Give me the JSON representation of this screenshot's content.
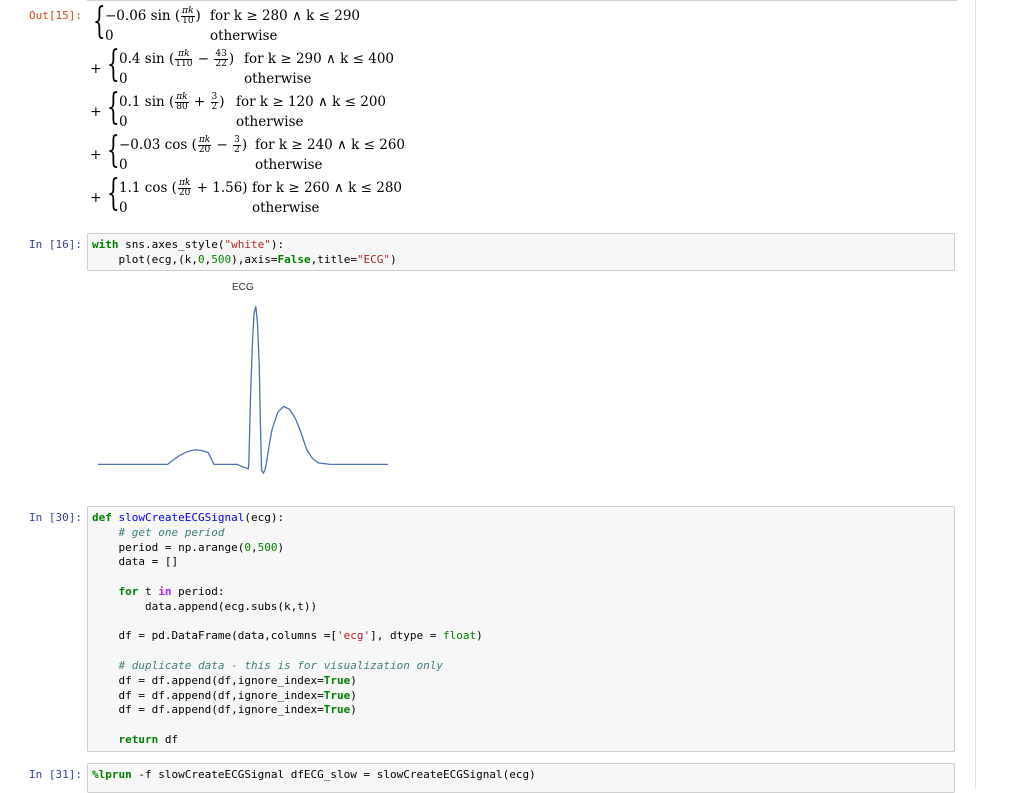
{
  "out15": {
    "prompt": "Out[15]:",
    "rows": [
      {
        "coef": "−0.06 sin",
        "arg_pre": "",
        "fnum": "πk",
        "fden": "10",
        "arg_post": "",
        "cond": "for k ≥ 280 ∧ k ≤ 290",
        "zero": "0",
        "otherwise": "otherwise",
        "plus": ""
      },
      {
        "coef": "0.4 sin",
        "arg_pre": "",
        "fnum": "πk",
        "fden": "110",
        "arg_post": "−",
        "fnum2": "43",
        "fden2": "22",
        "cond": "for k ≥ 290 ∧ k ≤ 400",
        "zero": "0",
        "otherwise": "otherwise",
        "plus": "+"
      },
      {
        "coef": "0.1 sin",
        "fnum": "πk",
        "fden": "80",
        "arg_post": "+",
        "fnum2": "3",
        "fden2": "2",
        "cond": "for k ≥ 120 ∧ k ≤ 200",
        "zero": "0",
        "otherwise": "otherwise",
        "plus": "+"
      },
      {
        "coef": "−0.03 cos",
        "fnum": "πk",
        "fden": "20",
        "arg_post": "−",
        "fnum2": "3",
        "fden2": "2",
        "cond": "for k ≥ 240 ∧ k ≤ 260",
        "zero": "0",
        "otherwise": "otherwise",
        "plus": "+"
      },
      {
        "coef": "1.1 cos",
        "fnum": "πk",
        "fden": "20",
        "arg_post": "+ 1.56",
        "cond": "for k ≥ 260 ∧ k ≤ 280",
        "zero": "0",
        "otherwise": "otherwise",
        "plus": "+"
      }
    ]
  },
  "in16": {
    "prompt": "In [16]:",
    "chart_title": "ECG"
  },
  "in30": {
    "prompt": "In [30]:"
  },
  "in31": {
    "prompt": "In [31]:"
  },
  "chart_data": {
    "type": "line",
    "title": "ECG",
    "xlabel": "",
    "ylabel": "",
    "axis": false,
    "x_range": [
      0,
      500
    ],
    "series": [
      {
        "color": "#4c72b0",
        "points": [
          [
            0,
            0
          ],
          [
            110,
            0
          ],
          [
            120,
            0
          ],
          [
            130,
            0.031
          ],
          [
            140,
            0.059
          ],
          [
            150,
            0.081
          ],
          [
            160,
            0.095
          ],
          [
            170,
            0.1
          ],
          [
            180,
            0.095
          ],
          [
            190,
            0.081
          ],
          [
            200,
            0.0
          ],
          [
            210,
            0
          ],
          [
            240,
            0
          ],
          [
            245,
            -0.009
          ],
          [
            250,
            -0.017
          ],
          [
            255,
            -0.024
          ],
          [
            259,
            -0.03
          ],
          [
            260,
            0.0
          ],
          [
            263,
            0.46
          ],
          [
            266,
            0.82
          ],
          [
            269,
            1.04
          ],
          [
            272,
            1.09
          ],
          [
            275,
            0.97
          ],
          [
            278,
            0.69
          ],
          [
            280,
            0.28
          ],
          [
            282,
            -0.04
          ],
          [
            285,
            -0.06
          ],
          [
            288,
            -0.04
          ],
          [
            290,
            0.0
          ],
          [
            295,
            0.13
          ],
          [
            300,
            0.24
          ],
          [
            310,
            0.36
          ],
          [
            320,
            0.4
          ],
          [
            330,
            0.38
          ],
          [
            340,
            0.32
          ],
          [
            350,
            0.22
          ],
          [
            360,
            0.1
          ],
          [
            370,
            0.04
          ],
          [
            380,
            0.01
          ],
          [
            400,
            0.0
          ],
          [
            450,
            0
          ],
          [
            500,
            0
          ]
        ]
      }
    ],
    "ylim": [
      -0.08,
      1.12
    ]
  },
  "colors": {
    "out_prompt": "#d84315",
    "in_prompt": "#303f9f",
    "line": "#4c72b0"
  }
}
